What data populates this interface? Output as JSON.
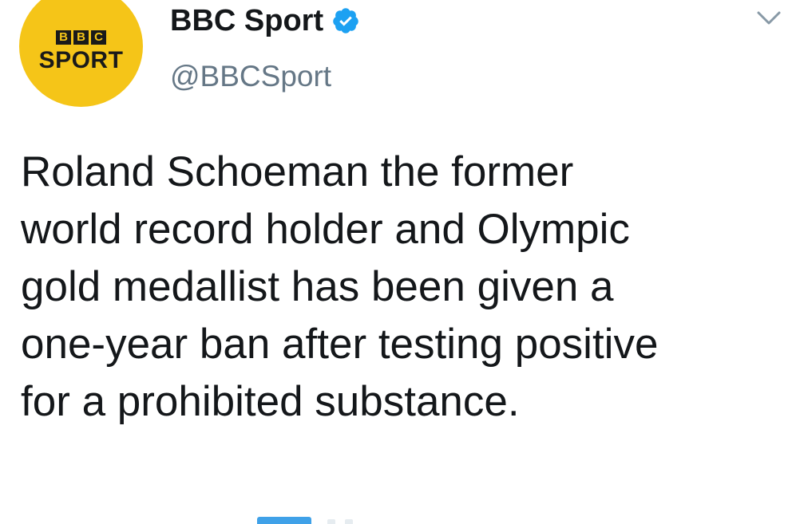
{
  "avatar": {
    "logo_blocks": [
      "B",
      "B",
      "C"
    ],
    "logo_sport": "SPORT",
    "color": "#f5c518"
  },
  "author": {
    "display_name": "BBC Sport",
    "handle": "@BBCSport",
    "verified_icon": "verified-badge-icon",
    "verified_color": "#1da1f2"
  },
  "menu": {
    "icon": "chevron-down-icon"
  },
  "tweet": {
    "text": "Roland Schoeman the former\nworld record holder and Olympic\ngold medallist has been given a\none-year ban after testing positive\nfor a prohibited substance."
  },
  "colors": {
    "text": "#14171a",
    "secondary": "#657786",
    "accent": "#1da1f2"
  }
}
